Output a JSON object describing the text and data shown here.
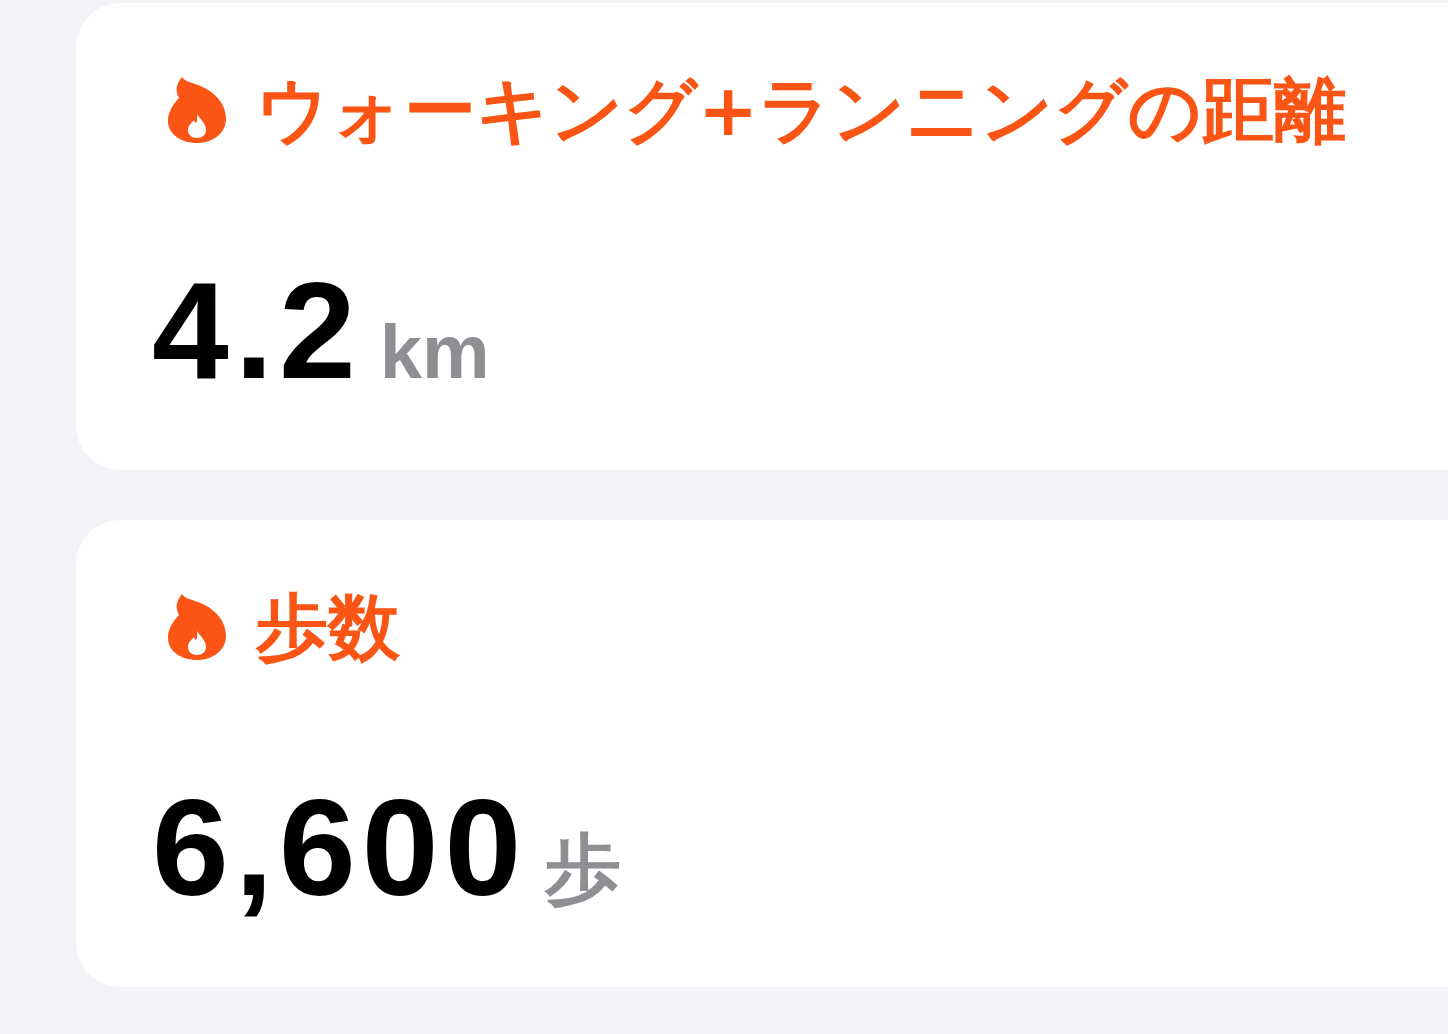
{
  "cards": [
    {
      "title": "ウォーキング+ランニングの距離",
      "value": "4.2",
      "unit": "km"
    },
    {
      "title": "歩数",
      "value": "6,600",
      "unit": "歩"
    }
  ]
}
